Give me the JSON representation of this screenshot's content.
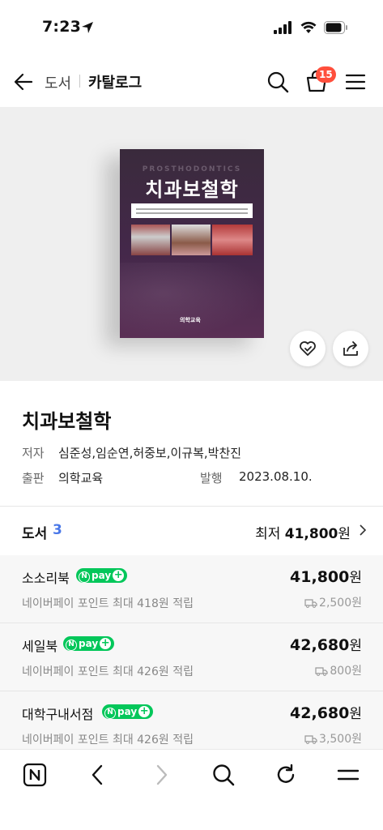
{
  "status_bar": {
    "time": "7:23"
  },
  "header": {
    "breadcrumb_1": "도서",
    "breadcrumb_2": "카탈로그",
    "cart_badge": "15"
  },
  "book": {
    "cover_subtitle": "PROSTHODONTICS",
    "cover_title": "치과보철학",
    "cover_publisher": "의학교육",
    "title": "치과보철학",
    "author_label": "저자",
    "authors": "심준성,임순연,허중보,이규복,박찬진",
    "publisher_label": "출판",
    "publisher": "의학교육",
    "date_label": "발행",
    "date": "2023.08.10."
  },
  "offers": {
    "section_title": "도서",
    "count": "3",
    "lowest_prefix": "최저",
    "lowest_price": "41,800",
    "lowest_unit": "원",
    "npay_label": "pay",
    "stores": [
      {
        "name": "소소리북",
        "point": "네이버페이 포인트 최대 418원 적립",
        "price": "41,800",
        "unit": "원",
        "shipping": "2,500원"
      },
      {
        "name": "세일북",
        "point": "네이버페이 포인트 최대 426원 적립",
        "price": "42,680",
        "unit": "원",
        "shipping": "800원"
      },
      {
        "name": "대학구내서점",
        "point": "네이버페이 포인트 최대 426원 적립",
        "price": "42,680",
        "unit": "원",
        "shipping": "3,500원"
      }
    ]
  },
  "colors": {
    "accent_blue": "#4a78e8",
    "npay_green": "#03c75a",
    "badge_red": "#ff4f3c"
  },
  "icons": [
    "location-arrow-icon",
    "signal-icon",
    "wifi-icon",
    "battery-icon",
    "back-arrow-icon",
    "search-icon",
    "cart-icon",
    "menu-icon",
    "wishlist-heart-icon",
    "share-icon",
    "chevron-right-icon",
    "truck-icon",
    "naver-home-icon",
    "browser-back-icon",
    "browser-forward-icon",
    "browser-search-icon",
    "refresh-icon",
    "browser-menu-icon"
  ]
}
